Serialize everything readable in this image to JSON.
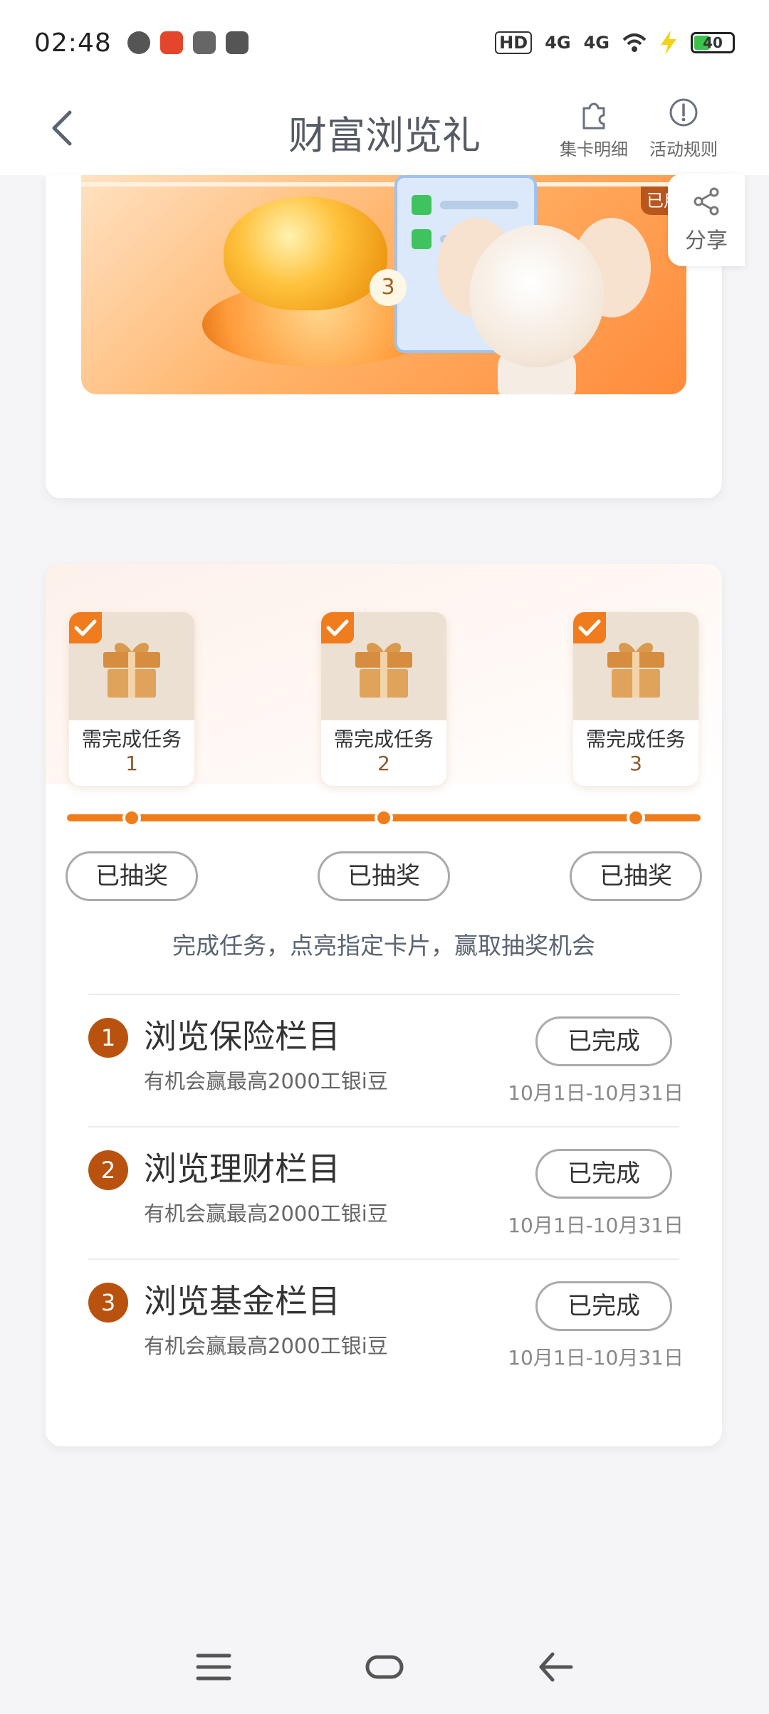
{
  "status_bar": {
    "time": "02:48",
    "signal_labels": [
      "HD",
      "4G",
      "4G"
    ],
    "battery": "40"
  },
  "header": {
    "title": "财富浏览礼",
    "actions": [
      {
        "label": "集卡明细",
        "icon": "puzzle-icon"
      },
      {
        "label": "活动规则",
        "icon": "info-circle-icon"
      }
    ]
  },
  "banner": {
    "used_tag": "已用",
    "step_badge": "3"
  },
  "share": {
    "label": "分享"
  },
  "rewards": [
    {
      "label": "需完成任务",
      "num": "1",
      "button": "已抽奖"
    },
    {
      "label": "需完成任务",
      "num": "2",
      "button": "已抽奖"
    },
    {
      "label": "需完成任务",
      "num": "3",
      "button": "已抽奖"
    }
  ],
  "hint": "完成任务，点亮指定卡片，赢取抽奖机会",
  "tasks": [
    {
      "num": "1",
      "title": "浏览保险栏目",
      "sub": "有机会赢最高2000工银i豆",
      "button": "已完成",
      "date": "10月1日-10月31日"
    },
    {
      "num": "2",
      "title": "浏览理财栏目",
      "sub": "有机会赢最高2000工银i豆",
      "button": "已完成",
      "date": "10月1日-10月31日"
    },
    {
      "num": "3",
      "title": "浏览基金栏目",
      "sub": "有机会赢最高2000工银i豆",
      "button": "已完成",
      "date": "10月1日-10月31日"
    }
  ],
  "colors": {
    "accent": "#ef7d1c",
    "task_badge": "#b9520f"
  }
}
